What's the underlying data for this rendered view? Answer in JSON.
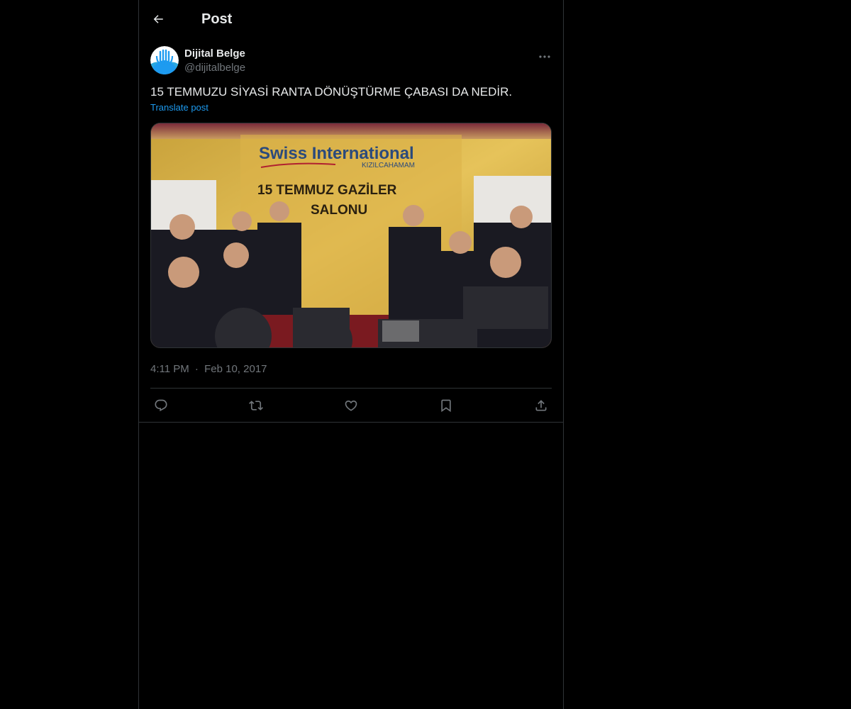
{
  "header": {
    "title": "Post",
    "back_icon": "arrow-left-icon"
  },
  "post": {
    "author": {
      "display_name": "Dijital Belge",
      "handle": "@dijitalbelge",
      "avatar_colors": [
        "#1da1f2",
        "#ffffff"
      ]
    },
    "text": "15 TEMMUZU SİYASİ RANTA DÖNÜŞTÜRME ÇABASI DA NEDİR.",
    "translate_label": "Translate post",
    "image": {
      "sign_brand": "Swiss International",
      "sign_location": "KIZILCAHAMAM",
      "sign_hall_line1": "15 TEMMUZ GAZİLER",
      "sign_hall_line2": "SALONU"
    },
    "time": "4:11 PM",
    "separator": "·",
    "date": "Feb 10, 2017"
  },
  "actions": [
    {
      "name": "reply",
      "icon": "reply-icon"
    },
    {
      "name": "repost",
      "icon": "repost-icon"
    },
    {
      "name": "like",
      "icon": "heart-icon"
    },
    {
      "name": "bookmark",
      "icon": "bookmark-icon"
    },
    {
      "name": "share",
      "icon": "share-icon"
    }
  ],
  "colors": {
    "background": "#000000",
    "text": "#e7e9ea",
    "muted": "#71767b",
    "link": "#1d9bf0",
    "border": "#2f3336"
  }
}
